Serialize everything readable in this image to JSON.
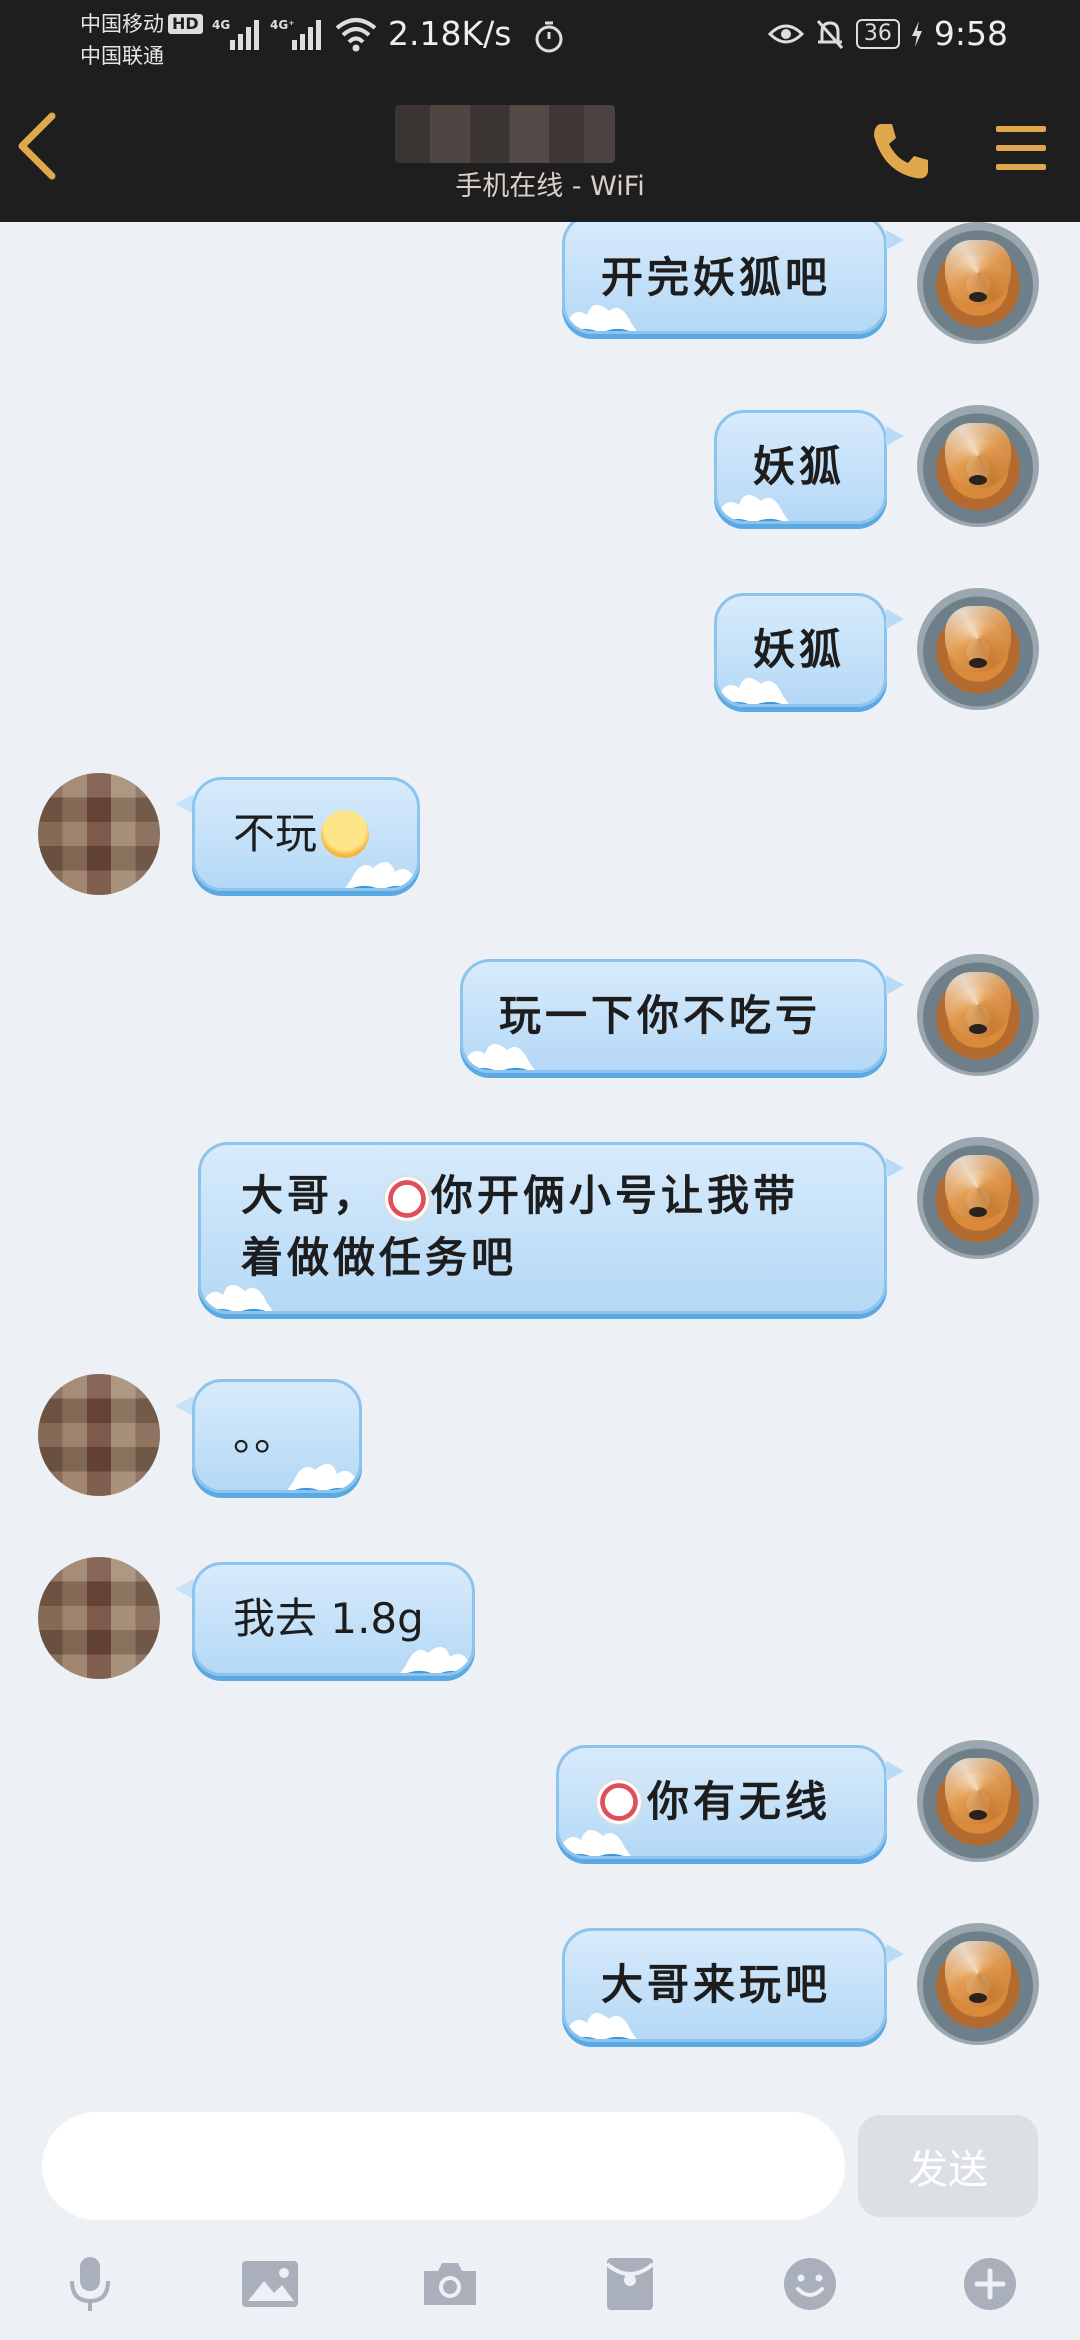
{
  "status_bar": {
    "carrier_1": "中国移动",
    "carrier_1_badge": "HD",
    "carrier_2": "中国联通",
    "signal_1_label": "4G",
    "signal_2_label": "4G⁺",
    "net_speed": "2.18K/s",
    "battery": "36",
    "time": "9:58"
  },
  "header": {
    "subtitle": "手机在线 - WiFi",
    "icons": [
      "back-icon",
      "phone-icon",
      "menu-icon"
    ]
  },
  "messages": [
    {
      "side": "mine",
      "text": "开完妖狐吧"
    },
    {
      "side": "mine",
      "text": "妖狐"
    },
    {
      "side": "mine",
      "text": "妖狐"
    },
    {
      "side": "theirs",
      "text": "不玩",
      "emoji": "squinting-face-emoji"
    },
    {
      "side": "mine",
      "text": "玩一下你不吃亏"
    },
    {
      "side": "mine",
      "text_1": "大哥，",
      "sticker": "crying-face-sticker",
      "text_2": "你开俩小号让我带",
      "text_3": "着做做任务吧"
    },
    {
      "side": "theirs",
      "text": "。。"
    },
    {
      "side": "theirs",
      "text": "我去 1.8g"
    },
    {
      "side": "mine",
      "sticker": "crying-face-sticker",
      "text": "你有无线"
    },
    {
      "side": "mine",
      "text": "大哥来玩吧"
    }
  ],
  "composer": {
    "input_value": "",
    "send_label": "发送"
  },
  "toolbar": [
    "mic-icon",
    "image-icon",
    "camera-icon",
    "red-packet-icon",
    "emoji-icon",
    "plus-icon"
  ],
  "colors": {
    "header_bg": "#1f1e1e",
    "accent_gold": "#e0a84a",
    "chat_bg": "#edf0f5",
    "bubble_blue": "#b4d8f6"
  }
}
